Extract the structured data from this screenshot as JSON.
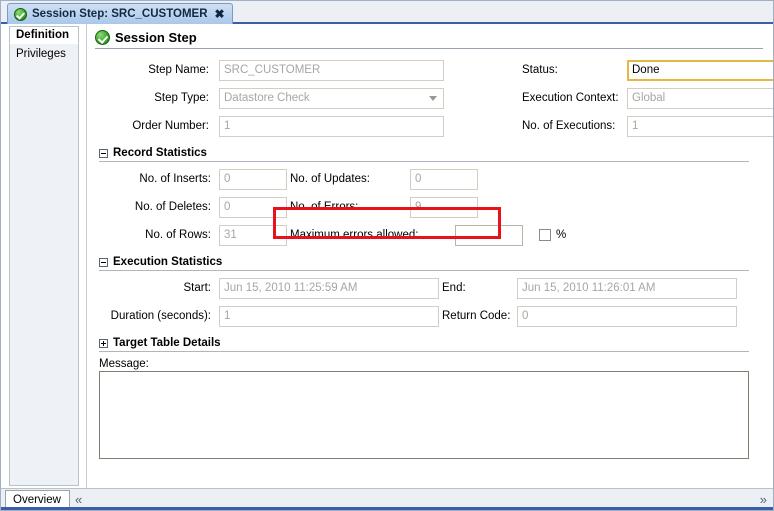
{
  "window": {
    "tab": {
      "icon": "green-check-icon",
      "title": "Session Step: SRC_CUSTOMER",
      "close_label": "✖"
    }
  },
  "sidebar": {
    "items": [
      {
        "label": "Definition",
        "active": true
      },
      {
        "label": "Privileges",
        "active": false
      }
    ]
  },
  "pane": {
    "icon": "green-check-icon",
    "title": "Session Step"
  },
  "definition": {
    "step_name": {
      "label": "Step Name:",
      "value": "SRC_CUSTOMER"
    },
    "step_type": {
      "label": "Step Type:",
      "value": "Datastore Check"
    },
    "order_number": {
      "label": "Order Number:",
      "value": "1"
    },
    "status": {
      "label": "Status:",
      "value": "Done",
      "focused": true
    },
    "execution_context": {
      "label": "Execution Context:",
      "value": "Global"
    },
    "no_of_executions": {
      "label": "No. of Executions:",
      "value": "1"
    }
  },
  "record_statistics": {
    "title": "Record Statistics",
    "expanded": true,
    "toggle_icon": "minus-box-icon",
    "fields": {
      "inserts": {
        "label": "No. of Inserts:",
        "value": "0"
      },
      "updates": {
        "label": "No. of Updates:",
        "value": "0"
      },
      "deletes": {
        "label": "No. of Deletes:",
        "value": "0"
      },
      "errors": {
        "label": "No. of Errors:",
        "value": "9",
        "highlighted": true
      },
      "rows": {
        "label": "No. of Rows:",
        "value": "31"
      },
      "max_errors": {
        "label": "Maximum errors allowed:",
        "value": ""
      }
    },
    "percent_checkbox": {
      "label": "%",
      "checked": false
    }
  },
  "execution_statistics": {
    "title": "Execution Statistics",
    "expanded": true,
    "toggle_icon": "minus-box-icon",
    "fields": {
      "start": {
        "label": "Start:",
        "value": "Jun 15, 2010 11:25:59 AM"
      },
      "end": {
        "label": "End:",
        "value": "Jun 15, 2010 11:26:01 AM"
      },
      "duration": {
        "label": "Duration (seconds):",
        "value": "1"
      },
      "return_code": {
        "label": "Return Code:",
        "value": "0"
      }
    }
  },
  "target_table_details": {
    "title": "Target Table Details",
    "expanded": false,
    "toggle_icon": "plus-box-icon"
  },
  "message": {
    "label": "Message:",
    "value": ""
  },
  "statusbar": {
    "overview_label": "Overview",
    "collapse_left_icon": "«",
    "expand_right_icon": "»"
  },
  "colors": {
    "accent_blue": "#3a5fa8",
    "tab_gradient_top": "#cfe0f4",
    "tab_gradient_bottom": "#a9c8ea",
    "panel_bg": "#eceff3",
    "focus_border": "#e3b843",
    "annotation_red": "#e8131a",
    "readonly_text": "#a6a6a6",
    "ok_green": "#3ba62c"
  }
}
